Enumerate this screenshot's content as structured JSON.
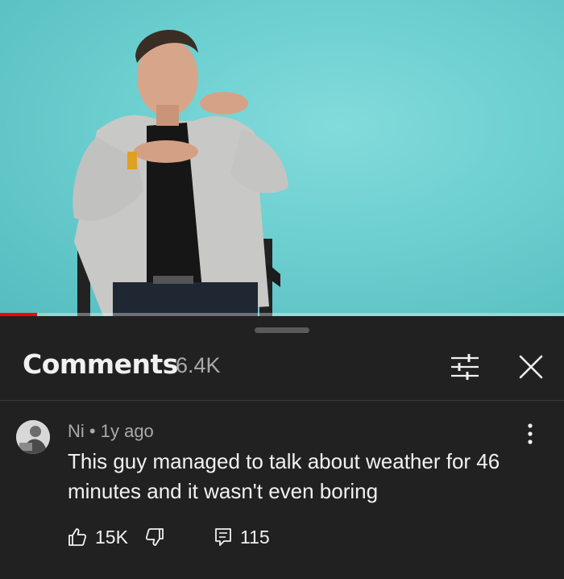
{
  "video": {
    "progress_fraction": 0.065
  },
  "comments_panel": {
    "title": "Comments",
    "count": "6.4K",
    "filter_icon": "sliders-icon",
    "close_icon": "close-icon"
  },
  "comment": {
    "author": "Ni",
    "separator": "•",
    "time_ago": "1y ago",
    "text": "This guy managed to talk about weather for 46 minutes and it wasn't even boring",
    "likes": "15K",
    "replies": "115",
    "icons": {
      "like": "thumbs-up-icon",
      "dislike": "thumbs-down-icon",
      "reply": "reply-icon",
      "more": "more-vertical-icon"
    }
  },
  "colors": {
    "sheet_bg": "#212121",
    "text_primary": "#f1f1f1",
    "text_secondary": "#aaaaaa",
    "progress": "#ff0000",
    "video_bg": "#6ccfd0"
  }
}
